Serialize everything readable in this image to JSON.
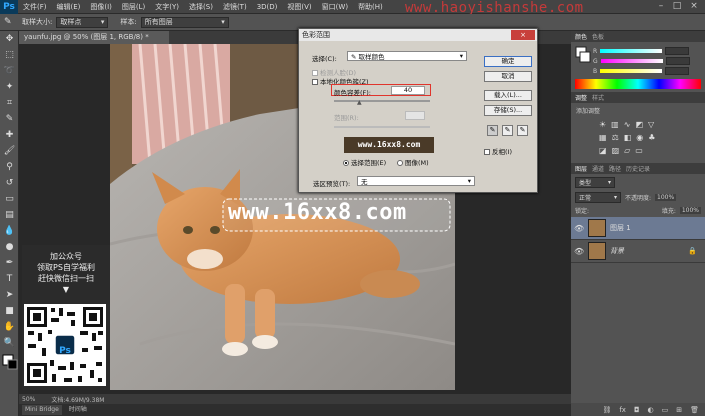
{
  "app": {
    "logo": "Ps",
    "menus": [
      "文件(F)",
      "编辑(E)",
      "图像(I)",
      "图层(L)",
      "文字(Y)",
      "选择(S)",
      "滤镜(T)",
      "3D(D)",
      "视图(V)",
      "窗口(W)",
      "帮助(H)"
    ],
    "watermark_text": "www.haoyishanshe.com"
  },
  "options_bar": {
    "sample_size_label": "取样大小:",
    "sample_size_value": "取样点",
    "sample_label": "样本:",
    "sample_value": "所有图层"
  },
  "document": {
    "tab_title": "yaunfu.jpg @ 50% (图层 1, RGB/8) *",
    "zoom": "50%",
    "doc_size": "文档:4.69M/9.38M",
    "bottom_tabs": [
      "Mini Bridge",
      "时间轴"
    ],
    "image_text": "www.16xx8.com"
  },
  "promo": {
    "lines": [
      "加公众号",
      "领取PS自学福利",
      "赶快微信扫一扫"
    ],
    "arrow": "▼",
    "qr_badge": "Ps"
  },
  "dialog": {
    "title": "色彩范围",
    "select_label": "选择(C):",
    "select_value": "取样颜色",
    "detect_faces": "检测人脸(D)",
    "localized_clusters": "本地化颜色簇(Z)",
    "fuzziness_label": "颜色容差(F):",
    "fuzziness_value": "40",
    "range_label": "范围(R):",
    "preview_text": "www.16xx8.com",
    "radio_selection": "选择范围(E)",
    "radio_image": "图像(M)",
    "selection_preview_label": "选区预览(T):",
    "selection_preview_value": "无",
    "buttons": {
      "ok": "确定",
      "cancel": "取消",
      "load": "载入(L)...",
      "save": "存储(S)..."
    },
    "invert_label": "反相(I)",
    "close_icon": "×"
  },
  "right_panel": {
    "color_tabs": [
      "颜色",
      "色板"
    ],
    "slider_labels": [
      "R",
      "G",
      "B"
    ],
    "adjust_tabs": [
      "调整",
      "样式"
    ],
    "adjust_title": "添加调整",
    "layer_tabs": [
      "图层",
      "通道",
      "路径",
      "历史记录"
    ],
    "blend_mode": "正常",
    "opacity_label": "不透明度:",
    "opacity_value": "100%",
    "lock_label": "锁定:",
    "fill_label": "填充:",
    "fill_value": "100%",
    "kind_label": "类型",
    "layers": [
      {
        "name": "图层 1",
        "selected": true
      },
      {
        "name": "背景",
        "selected": false
      }
    ]
  }
}
